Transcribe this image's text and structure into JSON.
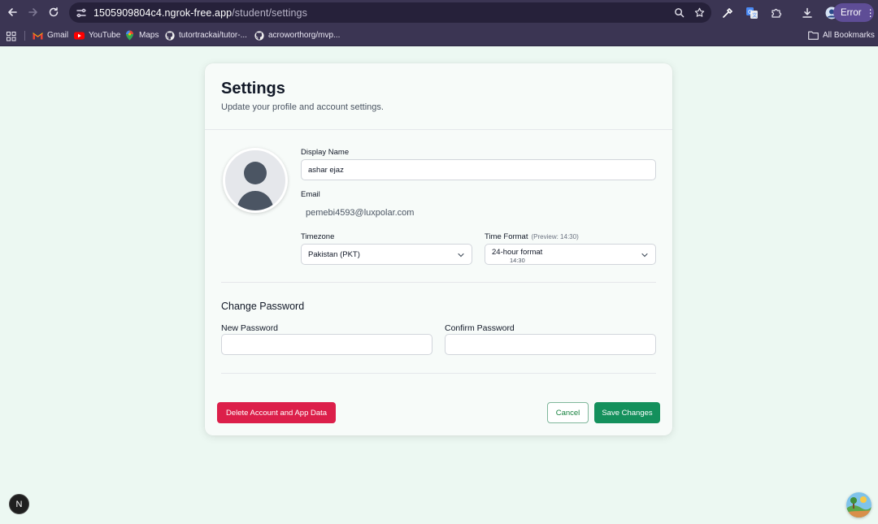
{
  "browser": {
    "url_host": "1505909804c4.ngrok-free.app",
    "url_path": "/student/settings",
    "profile_status": "Error",
    "bookmarks": [
      {
        "label": "Gmail",
        "icon": "gmail-icon"
      },
      {
        "label": "YouTube",
        "icon": "youtube-icon"
      },
      {
        "label": "Maps",
        "icon": "maps-icon"
      },
      {
        "label": "tutortrackai/tutor-...",
        "icon": "github-icon"
      },
      {
        "label": "acroworthorg/mvp...",
        "icon": "github-icon"
      }
    ],
    "all_bookmarks_label": "All Bookmarks"
  },
  "settings": {
    "title": "Settings",
    "subtitle": "Update your profile and account settings.",
    "display_name_label": "Display Name",
    "display_name_value": "ashar ejaz",
    "email_label": "Email",
    "email_value": "pemebi4593@luxpolar.com",
    "timezone_label": "Timezone",
    "timezone_value": "Pakistan (PKT)",
    "time_format_label": "Time Format",
    "time_format_preview": "(Preview: 14:30)",
    "time_format_value": "24-hour format",
    "time_format_example": "14:30",
    "change_password_title": "Change Password",
    "new_password_label": "New Password",
    "new_password_value": "",
    "confirm_password_label": "Confirm Password",
    "confirm_password_value": "",
    "delete_button": "Delete Account and App Data",
    "cancel_button": "Cancel",
    "save_button": "Save Changes"
  },
  "overlay": {
    "next_badge": "N"
  },
  "colors": {
    "page_bg": "#ecf8f2",
    "danger": "#dc1f4a",
    "primary": "#14905c",
    "browser_chrome": "#3b3553"
  }
}
